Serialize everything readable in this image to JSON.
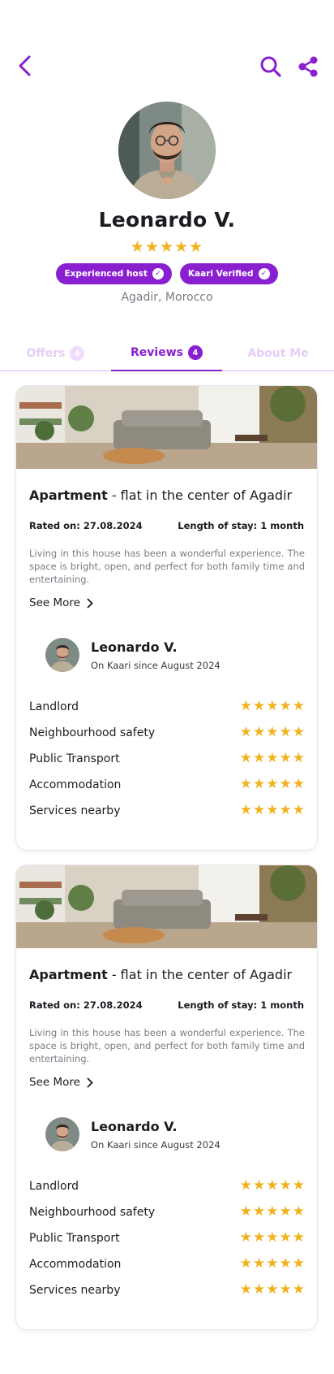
{
  "profile": {
    "name": "Leonardo V.",
    "stars": "★★★★★",
    "badges": [
      "Experienced host",
      "Kaari Verified"
    ],
    "location": "Agadir, Morocco"
  },
  "tabs": [
    {
      "label": "Offers",
      "count": "4"
    },
    {
      "label": "Reviews",
      "count": "4"
    },
    {
      "label": "About Me"
    }
  ],
  "icons": {
    "back": "chevron-left-icon",
    "search": "search-icon",
    "share": "share-icon",
    "check": "check-badge-icon",
    "see_more": "chevron-right-icon"
  },
  "colors": {
    "accent": "#8a1fcf",
    "star": "#f2b21f",
    "tab_inactive": "#e7cdf7"
  },
  "reviews": [
    {
      "type": "Apartment",
      "title_rest": " - flat in the center of Agadir",
      "rated_on": "Rated on: 27.08.2024",
      "length_of_stay": "Length of stay: 1 month",
      "text": "Living in this house has been a wonderful experience. The space is bright, open, and perfect for both family time and entertaining.",
      "see_more": "See More",
      "reviewer": {
        "name": "Leonardo V.",
        "since": "On Kaari since August 2024"
      },
      "ratings": [
        {
          "label": "Landlord",
          "stars": "★★★★★"
        },
        {
          "label": "Neighbourhood safety",
          "stars": "★★★★★"
        },
        {
          "label": "Public Transport",
          "stars": "★★★★★"
        },
        {
          "label": "Accommodation",
          "stars": "★★★★★"
        },
        {
          "label": "Services nearby",
          "stars": "★★★★★"
        }
      ]
    },
    {
      "type": "Apartment",
      "title_rest": " - flat in the center of Agadir",
      "rated_on": "Rated on: 27.08.2024",
      "length_of_stay": "Length of stay: 1 month",
      "text": "Living in this house has been a wonderful experience. The space is bright, open, and perfect for both family time and entertaining.",
      "see_more": "See More",
      "reviewer": {
        "name": "Leonardo V.",
        "since": "On Kaari since August 2024"
      },
      "ratings": [
        {
          "label": "Landlord",
          "stars": "★★★★★"
        },
        {
          "label": "Neighbourhood safety",
          "stars": "★★★★★"
        },
        {
          "label": "Public Transport",
          "stars": "★★★★★"
        },
        {
          "label": "Accommodation",
          "stars": "★★★★★"
        },
        {
          "label": "Services nearby",
          "stars": "★★★★★"
        }
      ]
    }
  ]
}
